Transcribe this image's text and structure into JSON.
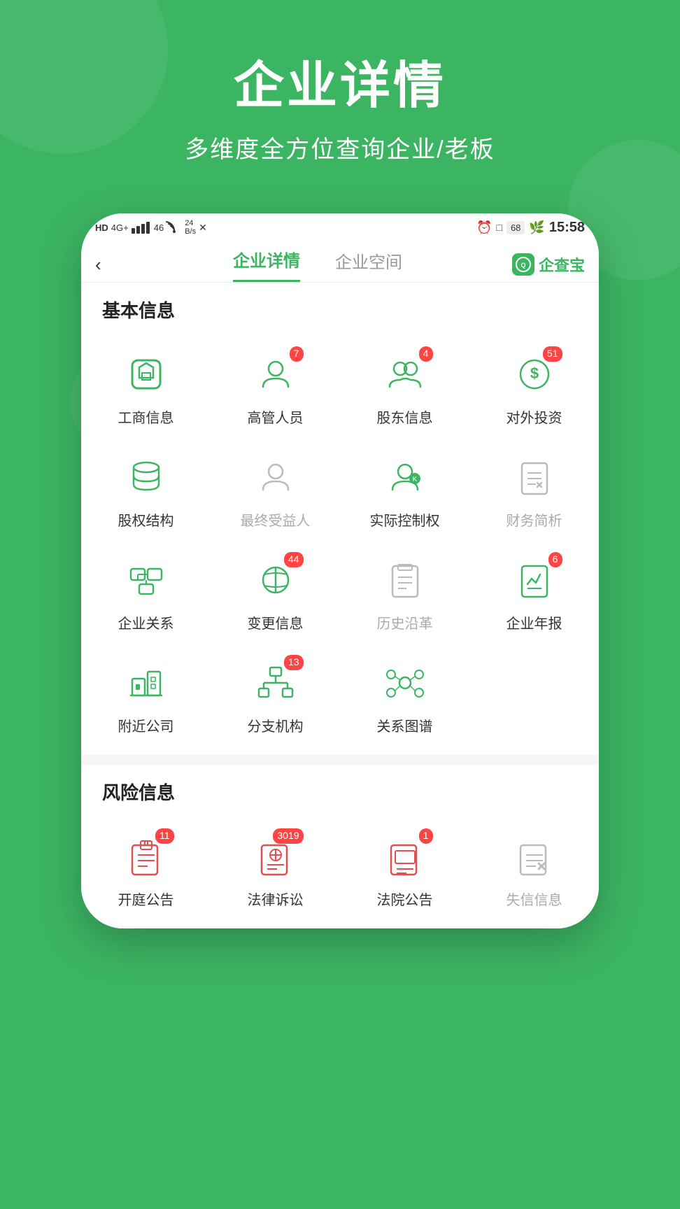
{
  "hero": {
    "title": "企业详情",
    "subtitle": "多维度全方位查询企业/老板"
  },
  "status_bar": {
    "left": "HD 4G+ 46 ▲",
    "signal": "24 B/s",
    "time": "15:58",
    "battery": "68"
  },
  "nav": {
    "back_label": "‹",
    "tabs": [
      {
        "label": "企业详情",
        "active": true
      },
      {
        "label": "企业空间",
        "active": false
      }
    ],
    "logo_label": "企查宝"
  },
  "basic_info": {
    "section_title": "基本信息",
    "items": [
      {
        "label": "工商信息",
        "icon": "shield-icon",
        "badge": null,
        "disabled": false
      },
      {
        "label": "高管人员",
        "icon": "person-icon",
        "badge": "7",
        "disabled": false
      },
      {
        "label": "股东信息",
        "icon": "persons-icon",
        "badge": "4",
        "disabled": false
      },
      {
        "label": "对外投资",
        "icon": "dollar-icon",
        "badge": "51",
        "disabled": false
      },
      {
        "label": "股权结构",
        "icon": "database-icon",
        "badge": null,
        "disabled": false
      },
      {
        "label": "最终受益人",
        "icon": "person2-icon",
        "badge": null,
        "disabled": true
      },
      {
        "label": "实际控制权",
        "icon": "control-icon",
        "badge": null,
        "disabled": false
      },
      {
        "label": "财务简析",
        "icon": "finance-icon",
        "badge": null,
        "disabled": true
      },
      {
        "label": "企业关系",
        "icon": "relation-icon",
        "badge": null,
        "disabled": false
      },
      {
        "label": "变更信息",
        "icon": "change-icon",
        "badge": "44",
        "disabled": false
      },
      {
        "label": "历史沿革",
        "icon": "history-icon",
        "badge": null,
        "disabled": true
      },
      {
        "label": "企业年报",
        "icon": "report-icon",
        "badge": "6",
        "disabled": false
      },
      {
        "label": "附近公司",
        "icon": "nearby-icon",
        "badge": null,
        "disabled": false
      },
      {
        "label": "分支机构",
        "icon": "branch-icon",
        "badge": "13",
        "disabled": false
      },
      {
        "label": "关系图谱",
        "icon": "graph-icon",
        "badge": null,
        "disabled": false
      }
    ]
  },
  "risk_info": {
    "section_title": "风险信息",
    "items": [
      {
        "label": "开庭公告",
        "icon": "court-icon",
        "badge": "11",
        "disabled": false
      },
      {
        "label": "法律诉讼",
        "icon": "law-icon",
        "badge": "3019",
        "disabled": false
      },
      {
        "label": "法院公告",
        "icon": "court2-icon",
        "badge": "1",
        "disabled": false
      },
      {
        "label": "失信信息",
        "icon": "credit-icon",
        "badge": null,
        "disabled": true
      }
    ]
  }
}
